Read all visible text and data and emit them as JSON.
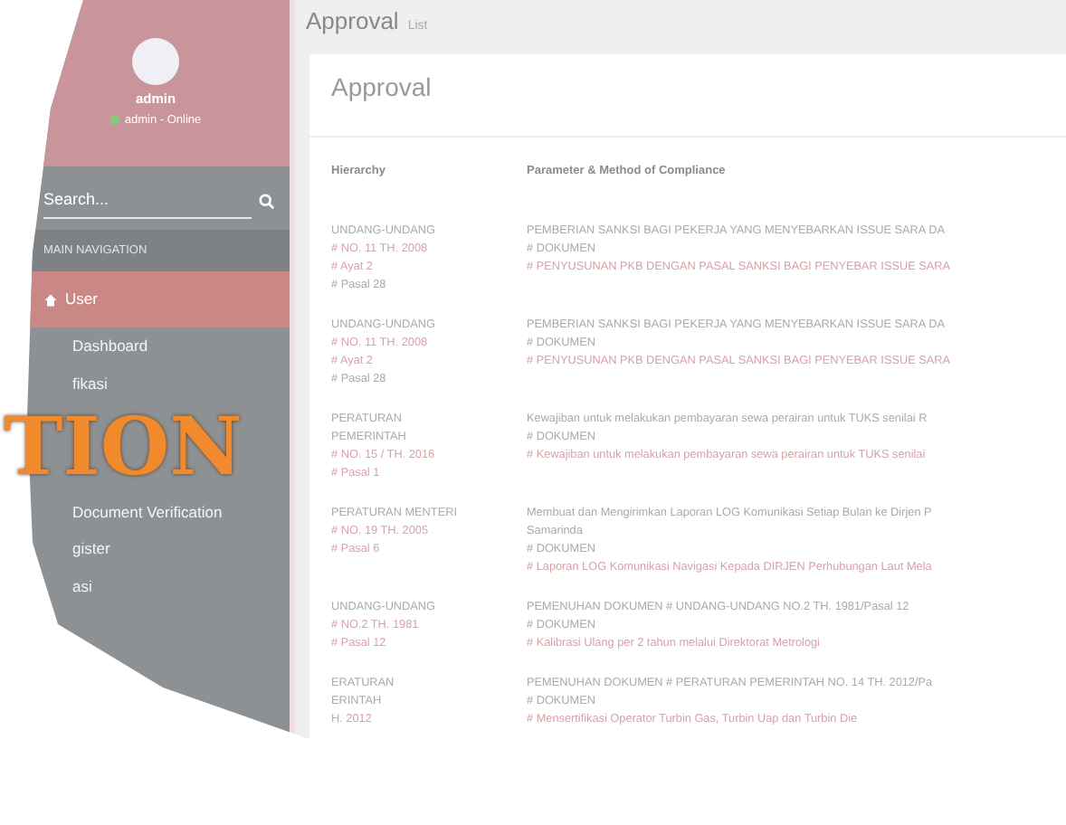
{
  "sidebar": {
    "user": {
      "name": "admin",
      "status": "admin - Online",
      "online": true
    },
    "search": {
      "placeholder": "Search..."
    },
    "section_header": "MAIN NAVIGATION",
    "items": [
      {
        "label": "User",
        "selected": true
      },
      {
        "label": "Dashboard",
        "selected": false
      },
      {
        "label": "fikasi",
        "selected": false
      },
      {
        "label": "Document Verification",
        "selected": false
      },
      {
        "label": "gister",
        "selected": false
      },
      {
        "label": "asi",
        "selected": false
      }
    ]
  },
  "overlay_text": "TION",
  "page": {
    "title": "Approval",
    "subtitle": "List"
  },
  "card": {
    "title": "Approval",
    "table": {
      "columns": [
        "Hierarchy",
        "Parameter & Method of Compliance"
      ],
      "rows": [
        {
          "hierarchy": [
            {
              "text": "UNDANG-UNDANG",
              "link": false
            },
            {
              "text": "# NO. 11 TH. 2008",
              "link": true
            },
            {
              "text": "# Ayat 2",
              "link": true
            },
            {
              "text": "# Pasal 28",
              "link": false
            }
          ],
          "parameter": [
            {
              "text": "PEMBERIAN SANKSI BAGI PEKERJA YANG MENYEBARKAN ISSUE SARA DA",
              "link": false
            },
            {
              "text": "# DOKUMEN",
              "link": false
            },
            {
              "text": "# PENYUSUNAN PKB DENGAN PASAL SANKSI BAGI PENYEBAR ISSUE SARA",
              "link": true
            }
          ]
        },
        {
          "hierarchy": [
            {
              "text": "UNDANG-UNDANG",
              "link": false
            },
            {
              "text": "# NO. 11 TH. 2008",
              "link": true
            },
            {
              "text": "# Ayat 2",
              "link": true
            },
            {
              "text": "# Pasal 28",
              "link": false
            }
          ],
          "parameter": [
            {
              "text": "PEMBERIAN SANKSI BAGI PEKERJA YANG MENYEBARKAN ISSUE SARA DA",
              "link": false
            },
            {
              "text": "# DOKUMEN",
              "link": false
            },
            {
              "text": "# PENYUSUNAN PKB DENGAN PASAL SANKSI BAGI PENYEBAR ISSUE SARA",
              "link": true
            }
          ]
        },
        {
          "hierarchy": [
            {
              "text": "PERATURAN",
              "link": false
            },
            {
              "text": "PEMERINTAH",
              "link": false
            },
            {
              "text": "# NO. 15 / TH. 2016",
              "link": true
            },
            {
              "text": "# Pasal 1",
              "link": true
            }
          ],
          "parameter": [
            {
              "text": "Kewajiban untuk melakukan pembayaran sewa perairan untuk TUKS senilai R",
              "link": false
            },
            {
              "text": "# DOKUMEN",
              "link": false
            },
            {
              "text": "# Kewajiban untuk melakukan pembayaran sewa perairan untuk TUKS senilai",
              "link": true
            }
          ]
        },
        {
          "hierarchy": [
            {
              "text": "PERATURAN MENTERI",
              "link": false
            },
            {
              "text": "# NO. 19 TH. 2005",
              "link": true
            },
            {
              "text": "# Pasal 6",
              "link": true
            }
          ],
          "parameter": [
            {
              "text": "Membuat dan Mengirimkan Laporan LOG Komunikasi Setiap Bulan ke Dirjen P",
              "link": false
            },
            {
              "text": "Samarinda",
              "link": false
            },
            {
              "text": "# DOKUMEN",
              "link": false
            },
            {
              "text": "# Laporan LOG Komunikasi Navigasi Kepada DIRJEN Perhubungan Laut Mela",
              "link": true
            }
          ]
        },
        {
          "hierarchy": [
            {
              "text": "UNDANG-UNDANG",
              "link": false
            },
            {
              "text": "# NO.2 TH. 1981",
              "link": true
            },
            {
              "text": "# Pasal 12",
              "link": true
            }
          ],
          "parameter": [
            {
              "text": "PEMENUHAN DOKUMEN # UNDANG-UNDANG NO.2 TH. 1981/Pasal 12",
              "link": false
            },
            {
              "text": "# DOKUMEN",
              "link": false
            },
            {
              "text": "# Kalibrasi Ulang per 2 tahun melalui Direktorat Metrologi",
              "link": true
            }
          ]
        },
        {
          "hierarchy": [
            {
              "text": "ERATURAN",
              "link": false
            },
            {
              "text": "ERINTAH",
              "link": false
            },
            {
              "text": "H. 2012",
              "link": true
            }
          ],
          "parameter": [
            {
              "text": "PEMENUHAN DOKUMEN # PERATURAN PEMERINTAH NO. 14 TH. 2012/Pa",
              "link": false
            },
            {
              "text": "# DOKUMEN",
              "link": false
            },
            {
              "text": "# Mensertifikasi Operator Turbin Gas, Turbin Uap dan Turbin Die",
              "link": true
            }
          ]
        }
      ]
    }
  }
}
